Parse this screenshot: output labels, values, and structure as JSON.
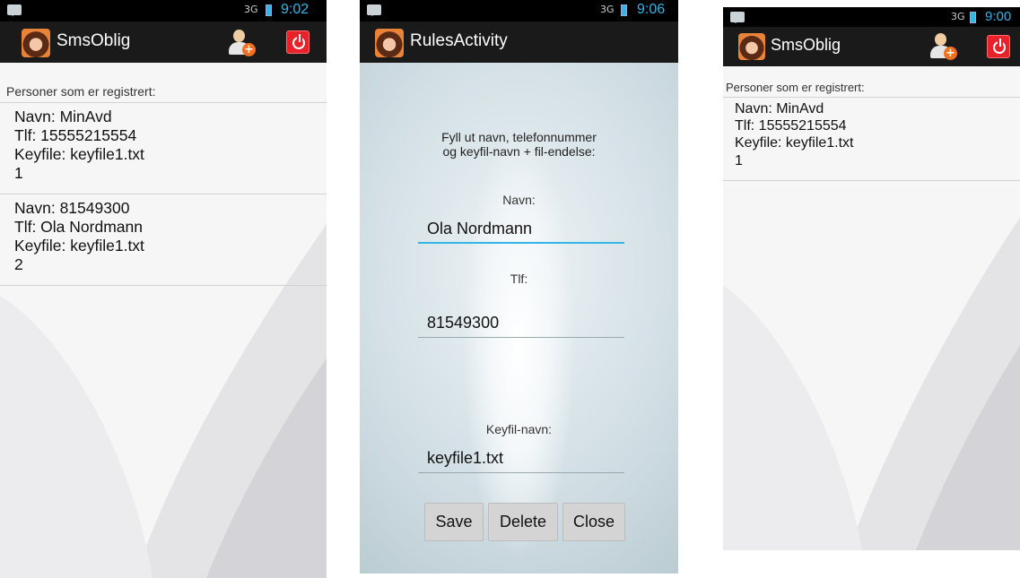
{
  "phone1": {
    "time": "9:02",
    "signal": "3G",
    "title": "SmsOblig",
    "list_header": "Personer som er registrert:",
    "records": [
      {
        "navn": "Navn: MinAvd",
        "tlf": "Tlf: 15555215554",
        "keyfile": "Keyfile: keyfile1.txt",
        "id": "1"
      },
      {
        "navn": "Navn: 81549300",
        "tlf": "Tlf: Ola Nordmann",
        "keyfile": "Keyfile: keyfile1.txt",
        "id": "2"
      }
    ]
  },
  "phone2": {
    "time": "9:06",
    "signal": "3G",
    "title": "RulesActivity",
    "intro_line1": "Fyll ut navn, telefonnummer",
    "intro_line2": "og keyfil-navn + fil-endelse:",
    "navn_label": "Navn:",
    "navn_value": "Ola Nordmann",
    "tlf_label": "Tlf:",
    "tlf_value": "81549300",
    "keyfil_label": "Keyfil-navn:",
    "keyfil_value": "keyfile1.txt",
    "save_label": "Save",
    "delete_label": "Delete",
    "close_label": "Close"
  },
  "phone3": {
    "time": "9:00",
    "signal": "3G",
    "title": "SmsOblig",
    "list_header": "Personer som er registrert:",
    "records": [
      {
        "navn": "Navn: MinAvd",
        "tlf": "Tlf: 15555215554",
        "keyfile": "Keyfile: keyfile1.txt",
        "id": "1"
      }
    ]
  },
  "colors": {
    "accent": "#33b5e5",
    "actionbar": "#1a1a1a",
    "power": "#e8222a"
  }
}
